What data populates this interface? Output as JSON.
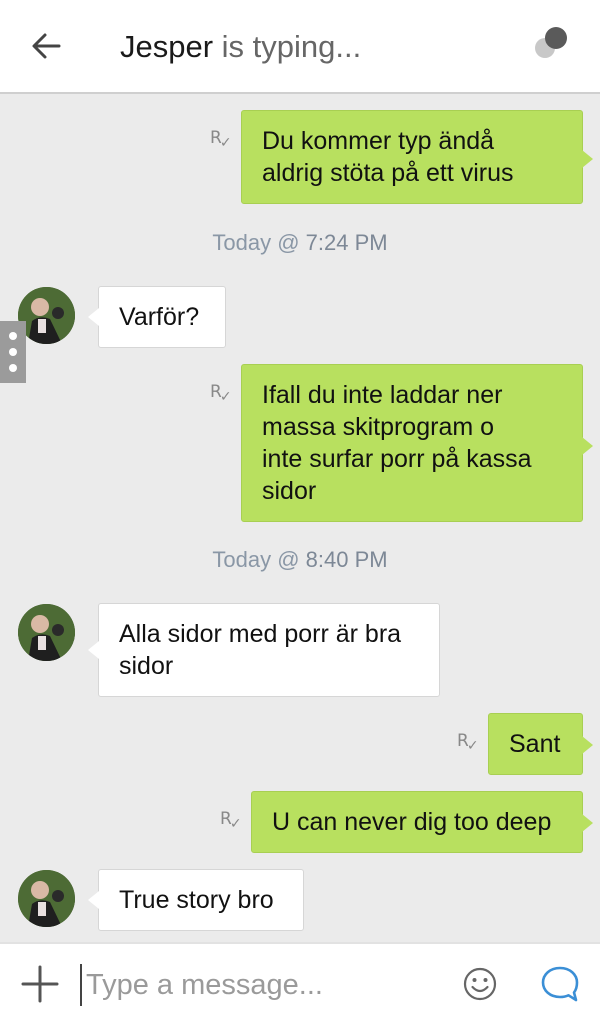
{
  "header": {
    "contact_name": "Jesper",
    "status": " is typing..."
  },
  "messages": [
    {
      "direction": "out",
      "lines": [
        "Du kommer typ ändå",
        "aldrig stöta på ett virus"
      ],
      "receipt": "R"
    },
    {
      "type": "timestamp",
      "prefix": "Today @ ",
      "time": "7:24 PM"
    },
    {
      "direction": "in",
      "lines": [
        "Varför?"
      ]
    },
    {
      "direction": "out",
      "lines": [
        "Ifall du inte laddar ner",
        "massa skitprogram o",
        "inte surfar porr på kassa",
        "sidor"
      ],
      "receipt": "R"
    },
    {
      "type": "timestamp",
      "prefix": "Today @ ",
      "time": "8:40 PM"
    },
    {
      "direction": "in",
      "lines": [
        "Alla sidor med porr är bra",
        "sidor"
      ]
    },
    {
      "direction": "out",
      "lines": [
        "Sant"
      ],
      "receipt": "R"
    },
    {
      "direction": "out",
      "lines": [
        "U can never dig too deep"
      ],
      "receipt": "R"
    },
    {
      "direction": "in",
      "lines": [
        "True story bro"
      ]
    }
  ],
  "composer": {
    "placeholder": "Type a message..."
  },
  "colors": {
    "outgoing_bubble": "#b8e05f",
    "incoming_bubble": "#ffffff",
    "background": "#ebebeb",
    "accent": "#3b8fd6",
    "timestamp": "#8a97a6"
  },
  "icons": {
    "back": "arrow-left-icon",
    "presence": "presence-dots-icon",
    "add": "plus-icon",
    "emoji": "smiley-icon",
    "send": "chat-bubble-icon",
    "receipt": "read-receipt-icon"
  }
}
